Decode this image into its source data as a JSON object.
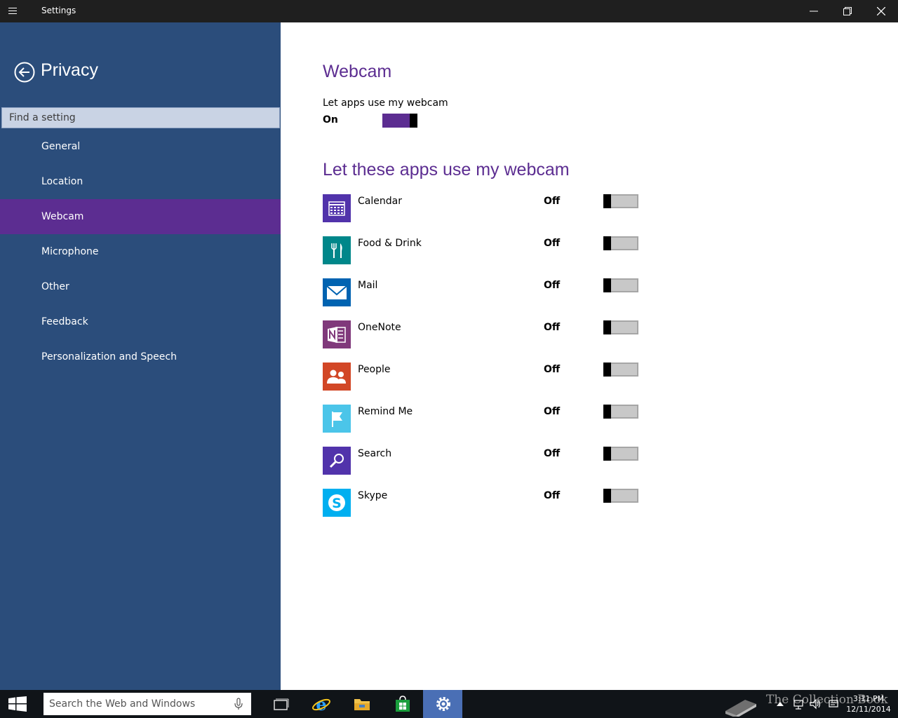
{
  "window": {
    "title": "Settings"
  },
  "sidebar": {
    "heading": "Privacy",
    "search_placeholder": "Find a setting",
    "items": [
      {
        "label": "General",
        "active": false
      },
      {
        "label": "Location",
        "active": false
      },
      {
        "label": "Webcam",
        "active": true
      },
      {
        "label": "Microphone",
        "active": false
      },
      {
        "label": "Other",
        "active": false
      },
      {
        "label": "Feedback",
        "active": false
      },
      {
        "label": "Personalization and Speech",
        "active": false
      }
    ]
  },
  "content": {
    "title": "Webcam",
    "master_label": "Let apps use my webcam",
    "master_state": "On",
    "apps_heading": "Let these apps use my webcam",
    "apps": [
      {
        "name": "Calendar",
        "state": "Off",
        "icon": "calendar-icon",
        "color": "#5133ab"
      },
      {
        "name": "Food & Drink",
        "state": "Off",
        "icon": "fork-knife-icon",
        "color": "#00878a"
      },
      {
        "name": "Mail",
        "state": "Off",
        "icon": "envelope-icon",
        "color": "#0063b1"
      },
      {
        "name": "OneNote",
        "state": "Off",
        "icon": "onenote-icon",
        "color": "#80397b"
      },
      {
        "name": "People",
        "state": "Off",
        "icon": "people-icon",
        "color": "#d24726"
      },
      {
        "name": "Remind Me",
        "state": "Off",
        "icon": "flag-icon",
        "color": "#4bc5e9"
      },
      {
        "name": "Search",
        "state": "Off",
        "icon": "search-icon",
        "color": "#5133ab"
      },
      {
        "name": "Skype",
        "state": "Off",
        "icon": "skype-icon",
        "color": "#00aff0"
      }
    ]
  },
  "taskbar": {
    "search_placeholder": "Search the Web and Windows",
    "watermark": "The Collection Book",
    "time": "3:11 PM",
    "date": "12/11/2014"
  },
  "colors": {
    "sidebar_bg": "#2b4d7b",
    "accent": "#5c2d91",
    "titlebar_bg": "#1f1f1f",
    "taskbar_bg": "#101418"
  }
}
